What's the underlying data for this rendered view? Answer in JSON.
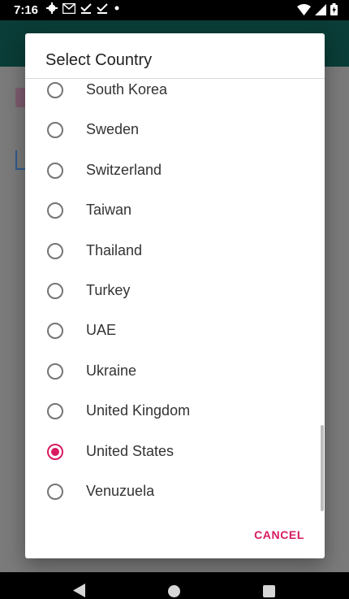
{
  "status_bar": {
    "time": "7:16",
    "icons_left": [
      "gear-icon",
      "gmail-icon",
      "check-icon",
      "check-icon",
      "dot-icon"
    ],
    "icons_right": [
      "wifi-icon",
      "signal-icon",
      "battery-icon"
    ]
  },
  "dialog": {
    "title": "Select Country",
    "items": [
      {
        "label": "South Korea",
        "checked": false
      },
      {
        "label": "Sweden",
        "checked": false
      },
      {
        "label": "Switzerland",
        "checked": false
      },
      {
        "label": "Taiwan",
        "checked": false
      },
      {
        "label": "Thailand",
        "checked": false
      },
      {
        "label": "Turkey",
        "checked": false
      },
      {
        "label": "UAE",
        "checked": false
      },
      {
        "label": "Ukraine",
        "checked": false
      },
      {
        "label": "United Kingdom",
        "checked": false
      },
      {
        "label": "United States",
        "checked": true
      },
      {
        "label": "Venuzuela",
        "checked": false
      }
    ],
    "cancel_label": "CANCEL"
  },
  "colors": {
    "accent": "#d81b60",
    "toolbar": "#0a3d37"
  }
}
